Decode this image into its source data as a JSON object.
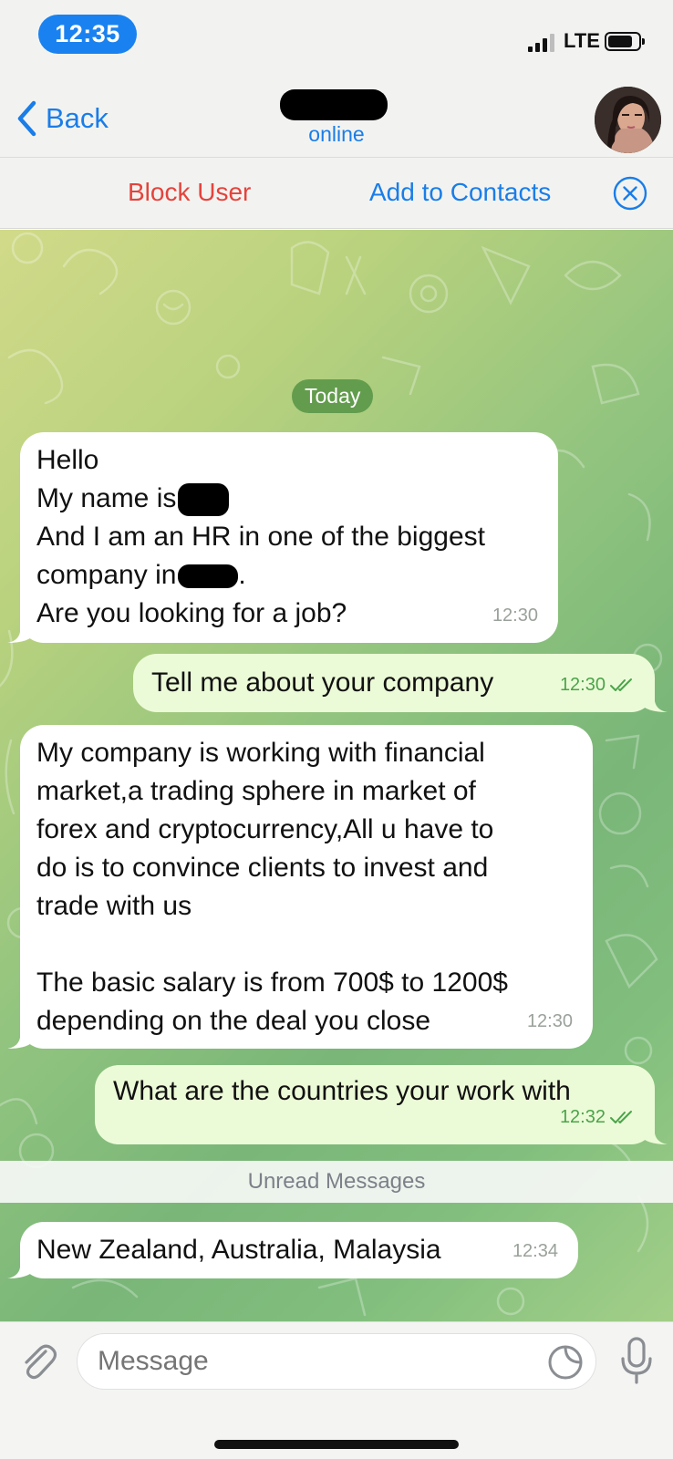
{
  "status_bar": {
    "time": "12:35",
    "network": "LTE",
    "icons": [
      "signal-icon",
      "battery-icon"
    ]
  },
  "header": {
    "back_label": "Back",
    "status": "online",
    "icons": [
      "chevron-left-icon",
      "avatar"
    ]
  },
  "action_bar": {
    "block_label": "Block User",
    "add_label": "Add to Contacts",
    "icons": [
      "close-circle-icon"
    ]
  },
  "chat": {
    "date_label": "Today",
    "messages": [
      {
        "direction": "incoming",
        "lines": [
          "Hello",
          "My name is",
          "And I am an HR in one of the biggest",
          "company in",
          "Are you looking for a job?"
        ],
        "time": "12:30"
      },
      {
        "direction": "outgoing",
        "text": "Tell me about your company",
        "time": "12:30",
        "read": true
      },
      {
        "direction": "incoming",
        "text": "My company is working with financial\nmarket,a trading sphere in market of\nforex and cryptocurrency,All u have to\ndo is to convince clients to invest and\ntrade with us\n\nThe basic salary is from 700$ to 1200$\ndepending on the deal you close",
        "time": "12:30"
      },
      {
        "direction": "outgoing",
        "text": "What are the countries your work with",
        "time": "12:32",
        "read": true
      },
      {
        "direction": "incoming",
        "text": "New Zealand, Australia, Malaysia",
        "time": "12:34"
      }
    ],
    "unread_label": "Unread Messages"
  },
  "input_bar": {
    "placeholder": "Message",
    "icons": [
      "paperclip-icon",
      "sticker-icon",
      "microphone-icon"
    ]
  },
  "colors": {
    "accent": "#1a7de8",
    "danger": "#e4433c",
    "outgoing_bubble": "#ecfbd7",
    "read_check": "#4aa44a"
  }
}
